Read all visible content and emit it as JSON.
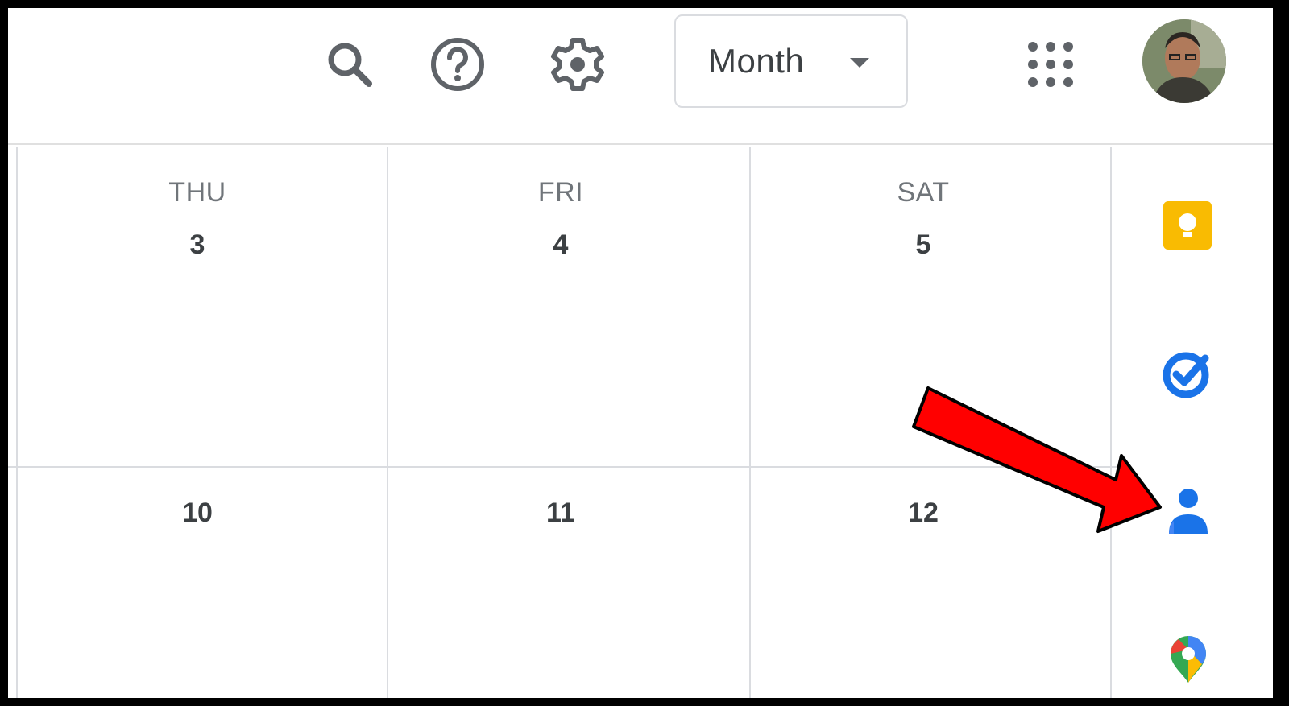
{
  "header": {
    "view_select": {
      "label": "Month"
    },
    "icons": [
      "search-icon",
      "help-icon",
      "settings-icon",
      "apps-grid-icon"
    ]
  },
  "calendar": {
    "days": [
      {
        "dow": "THU",
        "date": "3",
        "next_week_date": "10"
      },
      {
        "dow": "FRI",
        "date": "4",
        "next_week_date": "11"
      },
      {
        "dow": "SAT",
        "date": "5",
        "next_week_date": "12"
      }
    ]
  },
  "side_panel": {
    "items": [
      "keep-icon",
      "tasks-icon",
      "contacts-icon",
      "maps-icon"
    ]
  },
  "colors": {
    "keep": "#F9BB02",
    "tasks": "#1A73E8",
    "contacts": "#1A73E8",
    "annotation_arrow": "#FF0000"
  }
}
